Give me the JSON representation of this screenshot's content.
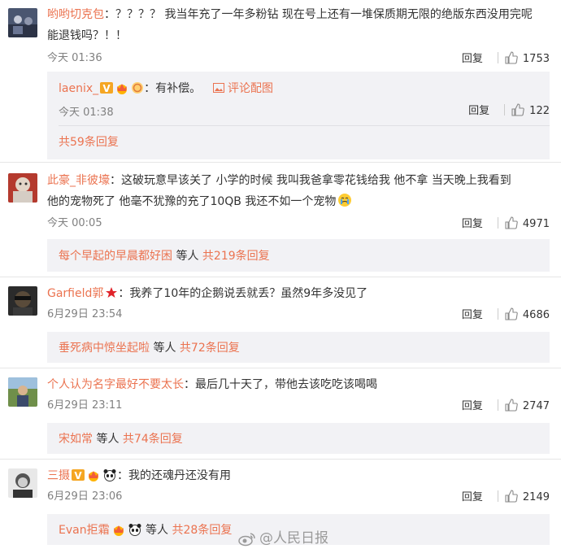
{
  "comments": [
    {
      "user": "哟哟切克包",
      "text_line1": "？？？？ 我当年充了一年多粉钻 现在号上还有一堆保质期无限的绝版东西没用完呢",
      "text_line2": "能退钱吗？！！",
      "time": "今天 01:36",
      "reply_label": "回复",
      "likes": "1753",
      "sub_reply": {
        "user": "laenix_",
        "text": "有补偿。",
        "pic_label": "评论配图",
        "time": "今天 01:38",
        "reply_label": "回复",
        "likes": "122"
      },
      "more_replies": "共59条回复"
    },
    {
      "user": "此豪_非彼壕",
      "text_line1": "这破玩意早该关了    小学的时候    我叫我爸拿零花钱给我    他不拿    当天晚上我看到",
      "text_line2": "他的宠物死了  他毫不犹豫的充了10QB    我还不如一个宠物",
      "time": "今天 00:05",
      "reply_label": "回复",
      "likes": "4971",
      "summary": {
        "who": "每个早起的早晨都好困",
        "etc": "等人",
        "count": "共219条回复"
      }
    },
    {
      "user": "Garfield郭",
      "text_line1": "我养了10年的企鹅说丢就丢？虽然9年多没见了",
      "time": "6月29日 23:54",
      "reply_label": "回复",
      "likes": "4686",
      "summary": {
        "who": "垂死病中惊坐起啦",
        "etc": "等人",
        "count": "共72条回复"
      }
    },
    {
      "user": "个人认为名字最好不要太长",
      "text_line1": "最后几十天了，带他去该吃吃该喝喝",
      "time": "6月29日 23:11",
      "reply_label": "回复",
      "likes": "2747",
      "summary": {
        "who": "宋如常",
        "etc": "等人",
        "count": "共74条回复"
      }
    },
    {
      "user": "三摄",
      "text_line1": "我的还魂丹还没有用",
      "time": "6月29日 23:06",
      "reply_label": "回复",
      "likes": "2149",
      "summary": {
        "who": "Evan拒霜",
        "etc": "等人",
        "count": "共28条回复"
      }
    }
  ],
  "watermark": "@人民日报",
  "colors": {
    "link": "#eb7350",
    "meta": "#808080",
    "subbox_bg": "#f2f2f5",
    "verified": "#f5a623"
  }
}
